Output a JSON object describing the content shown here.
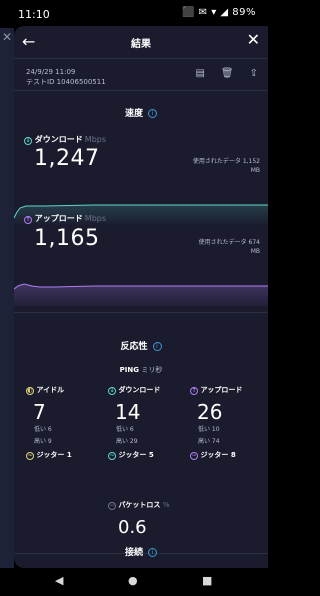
{
  "status_bar": {
    "time": "11:10",
    "icons": "⬛ ✉ ▾ ◢",
    "battery": "89%"
  },
  "header": {
    "title": "結果"
  },
  "meta": {
    "datetime": "24/9/29 11:09",
    "test_id": "テストID 10406500511"
  },
  "speed": {
    "title": "速度",
    "download": {
      "label": "ダウンロード",
      "unit": "Mbps",
      "value": "1,247",
      "used_label": "使用されたデータ",
      "used_value": "1,152",
      "used_unit": "MB"
    },
    "upload": {
      "label": "アップロード",
      "unit": "Mbps",
      "value": "1,165",
      "used_label": "使用されたデータ",
      "used_value": "674",
      "used_unit": "MB"
    }
  },
  "responsiveness": {
    "title": "反応性",
    "ping_label": "PING",
    "ping_unit": "ミリ秒",
    "idle": {
      "label": "アイドル",
      "value": "7",
      "low": "低い 6",
      "high": "高い 9",
      "jitter": "ジッター 1"
    },
    "download": {
      "label": "ダウンロード",
      "value": "14",
      "low": "低い 6",
      "high": "高い 29",
      "jitter": "ジッター 5"
    },
    "upload": {
      "label": "アップロード",
      "value": "26",
      "low": "低い 10",
      "high": "高い 74",
      "jitter": "ジッター 8"
    },
    "packet_loss": {
      "label": "パケットロス",
      "unit": "%",
      "value": "0.6"
    }
  },
  "connection": {
    "title": "接続"
  },
  "colors": {
    "download": "#5fd7c9",
    "upload": "#b27cf4",
    "background": "#1a1c2e",
    "info": "#3a9bd8"
  },
  "icons": [
    "arrow-left-icon",
    "close-icon",
    "document-icon",
    "trash-icon",
    "share-icon",
    "info-icon",
    "download-arrow-icon",
    "upload-arrow-icon",
    "idle-icon",
    "jitter-icon",
    "packet-loss-icon",
    "back-nav-icon",
    "home-nav-icon",
    "recents-nav-icon"
  ]
}
